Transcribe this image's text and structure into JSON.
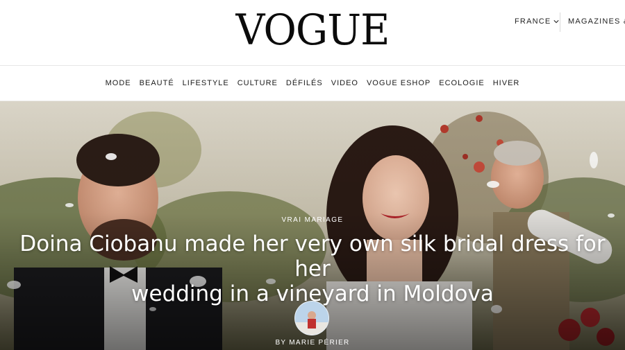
{
  "header": {
    "logo": "VOGUE",
    "region_label": "FRANCE",
    "magazines_label": "MAGAZINES & ABONNEMENTS"
  },
  "nav": {
    "items": [
      "MODE",
      "BEAUTÉ",
      "LIFESTYLE",
      "CULTURE",
      "DÉFILÉS",
      "VIDEO",
      "VOGUE ESHOP",
      "ECOLOGIE",
      "HIVER"
    ]
  },
  "hero": {
    "kicker": "VRAI MARIAGE",
    "headline_line1": "Doina Ciobanu made her very own silk bridal dress for her",
    "headline_line2": "wedding in a vineyard in Moldova",
    "byline": "BY MARIE PÉRIER"
  }
}
